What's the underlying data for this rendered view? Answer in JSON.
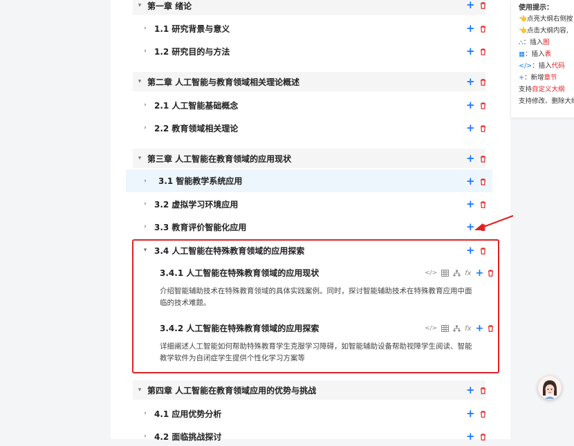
{
  "chapters": {
    "ch1": "第一章 绪论",
    "ch2": "第二章 人工智能与教育领域相关理论概述",
    "ch3": "第三章 人工智能在教育领域的应用现状",
    "ch4": "第四章 人工智能在教育领域应用的优势与挑战"
  },
  "sections": {
    "s11": "1.1 研究背景与意义",
    "s12": "1.2 研究目的与方法",
    "s21": "2.1 人工智能基础概念",
    "s22": "2.2 教育领域相关理论",
    "s31": "3.1 智能教学系统应用",
    "s32": "3.2 虚拟学习环境应用",
    "s33": "3.3 教育评价智能化应用",
    "s34": "3.4 人工智能在特殊教育领域的应用探索",
    "s41": "4.1 应用优势分析",
    "s42": "4.2 面临挑战探讨"
  },
  "subsections": {
    "s341_title": "3.4.1 人工智能在特殊教育领域的应用现状",
    "s341_line1": "介绍智能辅助技术在特殊教育领域的具体实践案例。同时，探讨智能辅助技术在特殊教育应用中面",
    "s341_line2": "临的技术难题。",
    "s342_title": "3.4.2 人工智能在特殊教育领域的应用探索",
    "s342_line1": "详细阐述人工智能如何帮助特殊教育学生克服学习障碍，如智能辅助设备帮助视障学生阅读、智能",
    "s342_line2": "教学软件为自闭症学生提供个性化学习方案等"
  },
  "tips": {
    "title": "使用提示：",
    "line1": "👈点亮大纲右侧按",
    "line2": "👈点击大纲内容,",
    "line3_pre": "：插入",
    "line3_red": "图",
    "line4_pre": "：插入",
    "line4_red": "表",
    "line5_pre": "：插入",
    "line5_red": "代码",
    "line6_pre": "：新增",
    "line6_red": "章节",
    "line7_pre": "支持",
    "line7_red": "自定义大纲",
    "line8": "支持修改、删除大纲"
  },
  "icons": {
    "add": "+",
    "chevron_right": "›",
    "chevron_down": "⌄",
    "code": "</>",
    "formula": "fx"
  },
  "colors": {
    "accent": "#1677ff",
    "danger": "#e02020",
    "highlight": "#eef6fd"
  }
}
